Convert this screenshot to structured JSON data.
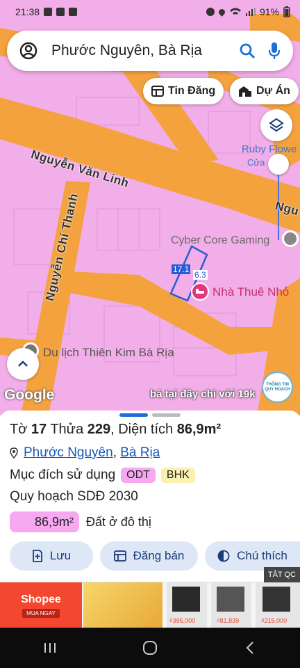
{
  "status_bar": {
    "time": "21:38",
    "battery": "91%"
  },
  "search": {
    "text": "Phước Nguyên, Bà Rịa"
  },
  "chips": {
    "posts": "Tin Đăng",
    "projects": "Dự Án"
  },
  "map": {
    "roads": {
      "nguyen_van_linh": "Nguyễn Văn Linh",
      "nguyen_chi_thanh": "Nguyễn Chí Thanh",
      "partial_right": "Ngu"
    },
    "places": {
      "ruby": "Ruby Flowe",
      "ruby_sub": "Cửa",
      "cyber": "Cyber Core Gaming",
      "nha_thue": "Nhà Thuê Nhỏ",
      "du_lich": "Du lịch Thiên Kim Bà Rịa"
    },
    "parcel_labels": {
      "left": "17.1",
      "right": "6.3"
    },
    "google": "Google",
    "promo": "bá tại đây chỉ với 19k",
    "info_badge": [
      "THÔNG TIN",
      "QUY HOẠCH"
    ]
  },
  "sheet": {
    "title_prefix": "Tờ ",
    "sheet_no": "17",
    "parcel_word": " Thửa ",
    "parcel_no": "229",
    "area_text": ", Diện tích ",
    "area": "86,9m²",
    "ward": "Phước Nguyên",
    "comma": ",",
    "city": "Bà Rịa",
    "purpose_label": "Mục đích sử dụng",
    "tags": [
      "ODT",
      "BHK"
    ],
    "plan": "Quy hoạch SDĐ 2030",
    "area_value": "86,9m²",
    "land_type": "Đất ở đô thị",
    "buttons": {
      "save": "Lưu",
      "post_sale": "Đăng bán",
      "legend": "Chú thích"
    }
  },
  "ad": {
    "close": "TẮT QC",
    "brand": "Shopee",
    "buy": "MUA NGAY",
    "prices": [
      "₫395,000",
      "₫81,839",
      "₫215,000"
    ]
  },
  "colors": {
    "map_pink": "#f2aee8",
    "road_orange": "#f4a23e",
    "accent_blue": "#1a58b8",
    "tag_pink": "#f6a9f0",
    "tag_yellow": "#fbf0b0",
    "button_bg": "#dde7f6"
  }
}
